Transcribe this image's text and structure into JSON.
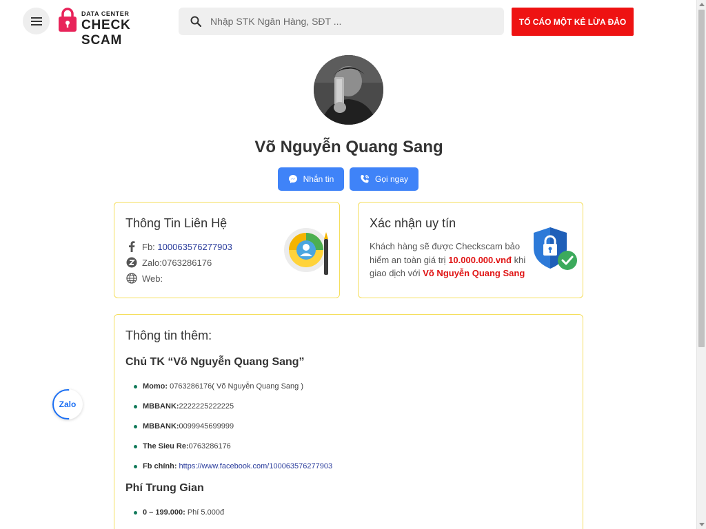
{
  "header": {
    "logo_small": "DATA CENTER",
    "logo_big": "CHECK SCAM",
    "search_placeholder": "Nhập STK Ngân Hàng, SĐT ...",
    "report_label": "TỐ CÁO MỘT KẺ LỪA ĐẢO"
  },
  "profile": {
    "name": "Võ Nguyễn Quang Sang",
    "message_label": "Nhắn tin",
    "call_label": "Gọi ngay"
  },
  "contact": {
    "title": "Thông Tin Liên Hệ",
    "fb_label": "Fb:",
    "fb_value": "100063576277903",
    "zalo_label": "Zalo:",
    "zalo_value": "0763286176",
    "web_label": "Web:"
  },
  "trust": {
    "title": "Xác nhận uy tín",
    "text_1": "Khách hàng sẽ được Checkscam bảo hiểm an toàn giá trị",
    "amount": "10.000.000.vnđ",
    "text_2": "khi giao dịch với",
    "name": "Võ Nguyễn Quang Sang"
  },
  "more": {
    "title": "Thông tin thêm:",
    "account_heading": "Chủ TK “Võ Nguyễn Quang Sang”",
    "items": [
      {
        "label": "Momo:",
        "value": "0763286176( Võ Nguyễn Quang Sang )"
      },
      {
        "label": "MBBANK:",
        "value": "2222225222225"
      },
      {
        "label": "MBBANK:",
        "value": "0099945699999"
      },
      {
        "label": "The Sieu Re:",
        "value": "0763286176"
      },
      {
        "label": "Fb chính:",
        "value": "https://www.facebook.com/100063576277903"
      }
    ],
    "fee_heading": "Phí Trung Gian",
    "fee_items": [
      {
        "label": "0 – 199.000:",
        "value": "Phí 5.000đ"
      }
    ]
  },
  "zalo_float_label": "Zalo",
  "colors": {
    "accent_red": "#ee1212",
    "button_blue": "#3f83f8",
    "card_border": "#f5de5b",
    "link_blue": "#2a3c9c",
    "bullet_green": "#137a5a"
  }
}
